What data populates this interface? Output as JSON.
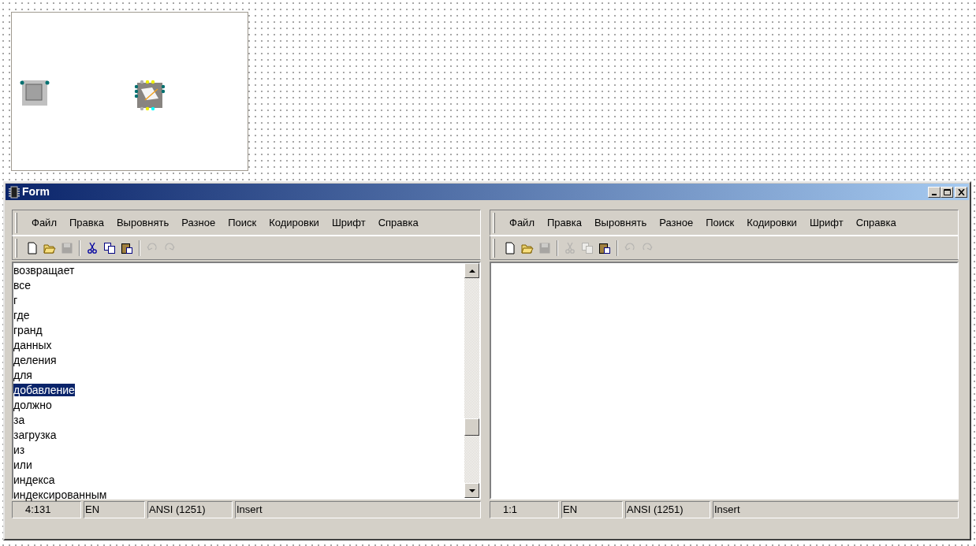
{
  "window": {
    "title": "Form"
  },
  "panes": [
    {
      "menu": [
        "Файл",
        "Правка",
        "Выровнять",
        "Разное",
        "Поиск",
        "Кодировки",
        "Шрифт",
        "Справка"
      ],
      "toolbar": [
        {
          "kind": "new",
          "disabled": false
        },
        {
          "kind": "open",
          "disabled": false
        },
        {
          "kind": "save",
          "disabled": true
        },
        {
          "kind": "separator"
        },
        {
          "kind": "cut",
          "disabled": false
        },
        {
          "kind": "copy",
          "disabled": false
        },
        {
          "kind": "paste",
          "disabled": false
        },
        {
          "kind": "separator"
        },
        {
          "kind": "undo",
          "disabled": true
        },
        {
          "kind": "redo",
          "disabled": true
        }
      ],
      "lines": [
        {
          "text": "возвращает",
          "selected": false
        },
        {
          "text": "все",
          "selected": false
        },
        {
          "text": "г",
          "selected": false
        },
        {
          "text": "где",
          "selected": false
        },
        {
          "text": "гранд",
          "selected": false
        },
        {
          "text": "данных",
          "selected": false
        },
        {
          "text": "деления",
          "selected": false
        },
        {
          "text": "для",
          "selected": false
        },
        {
          "text": "добавление",
          "selected": true
        },
        {
          "text": "должно",
          "selected": false
        },
        {
          "text": "за",
          "selected": false
        },
        {
          "text": "загрузка",
          "selected": false
        },
        {
          "text": "из",
          "selected": false
        },
        {
          "text": "или",
          "selected": false
        },
        {
          "text": "индекса",
          "selected": false
        },
        {
          "text": "индексированным",
          "selected": false
        }
      ],
      "scrollbar": true,
      "status": [
        "4:131",
        "EN",
        "ANSI (1251)",
        "Insert"
      ]
    },
    {
      "menu": [
        "Файл",
        "Правка",
        "Выровнять",
        "Разное",
        "Поиск",
        "Кодировки",
        "Шрифт",
        "Справка"
      ],
      "toolbar": [
        {
          "kind": "new",
          "disabled": false
        },
        {
          "kind": "open",
          "disabled": false
        },
        {
          "kind": "save",
          "disabled": true
        },
        {
          "kind": "separator"
        },
        {
          "kind": "cut",
          "disabled": true
        },
        {
          "kind": "copy",
          "disabled": true
        },
        {
          "kind": "paste",
          "disabled": false
        },
        {
          "kind": "separator"
        },
        {
          "kind": "undo",
          "disabled": true
        },
        {
          "kind": "redo",
          "disabled": true
        }
      ],
      "scrollbar": false,
      "status": [
        "1:1",
        "EN",
        "ANSI (1251)",
        "Insert"
      ]
    }
  ]
}
